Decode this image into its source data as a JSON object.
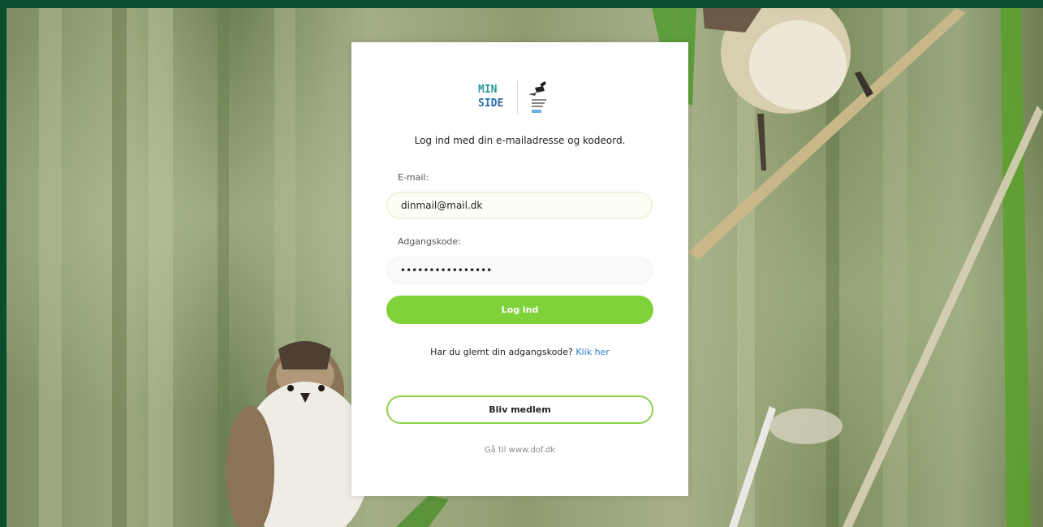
{
  "logo": {
    "line1": "MIN",
    "line2": "SIDE",
    "icon": "bird-logo-icon"
  },
  "login": {
    "intro": "Log ind med din e-mailadresse og kodeord.",
    "email_label": "E-mail:",
    "email_value": "dinmail@mail.dk",
    "password_label": "Adgangskode:",
    "password_value": "••••••••••••••••",
    "login_button": "Log ind",
    "forgot_text": "Har du glemt din adgangskode?",
    "forgot_link": "Klik her",
    "member_button": "Bliv medlem",
    "goto_link": "Gå til www.dof.dk"
  },
  "colors": {
    "frame": "#0a4d2e",
    "primary_button": "#7fd23a",
    "link": "#2b7fc4",
    "logo_teal": "#2a9a9a",
    "logo_blue": "#2b6fa8"
  }
}
